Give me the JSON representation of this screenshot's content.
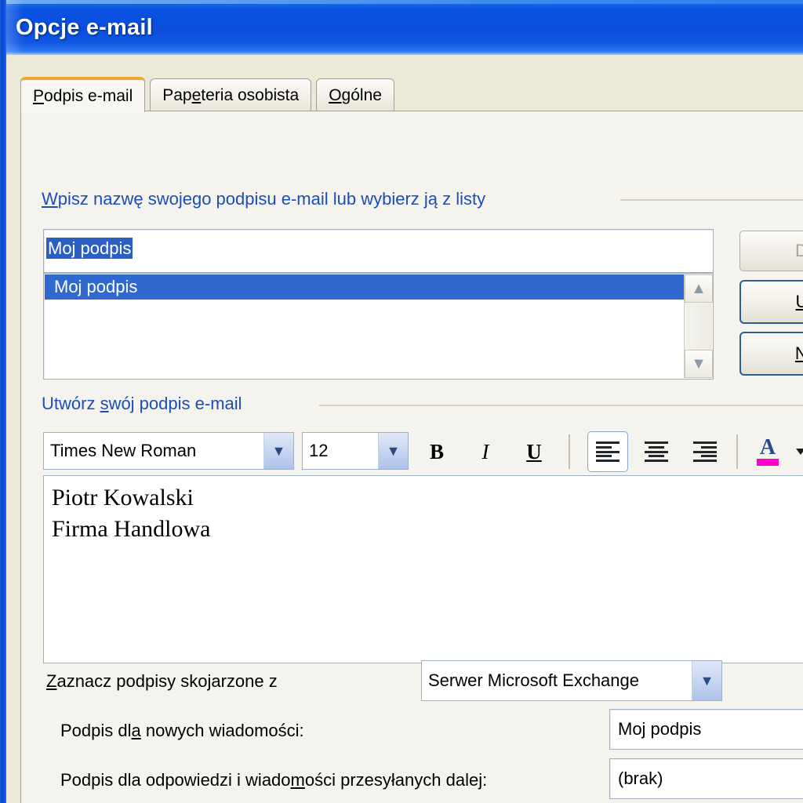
{
  "window": {
    "title": "Opcje e-mail",
    "accent_titlebar": "#0a4ddc",
    "accent_tab": "#f0a830"
  },
  "tabs": [
    {
      "label": "Podpis e-mail",
      "accesskey": "P",
      "active": true
    },
    {
      "label": "Papeteria osobista",
      "accesskey": "e",
      "active": false
    },
    {
      "label": "Ogólne",
      "accesskey": "O",
      "active": false
    }
  ],
  "signature_name_group": {
    "label": "Wpisz nazwę swojego podpisu e-mail lub wybierz ją z listy",
    "label_accesskey": "W",
    "name_input": {
      "value": "Moj podpis",
      "selected": true
    },
    "list": {
      "items": [
        "Moj podpis"
      ],
      "selected_index": 0,
      "scroll_up_icon": "chevron-up-icon",
      "scroll_down_icon": "chevron-down-icon"
    },
    "buttons": [
      {
        "label": "Dodaj",
        "accesskey": "D",
        "visible_text": "Do",
        "disabled": true,
        "default": false
      },
      {
        "label": "Usuń",
        "accesskey": "U",
        "visible_text": "Us",
        "disabled": false,
        "default": true
      },
      {
        "label": "Nowy",
        "accesskey": "N",
        "visible_text": "No",
        "disabled": false,
        "default": true
      }
    ]
  },
  "create_signature_group": {
    "label": "Utwórz swój podpis e-mail",
    "label_accesskey": "s",
    "toolbar": {
      "font_family": {
        "value": "Times New Roman"
      },
      "font_size": {
        "value": "12"
      },
      "bold": {
        "label": "B",
        "name": "bold-button"
      },
      "italic": {
        "label": "I",
        "name": "italic-button"
      },
      "underline": {
        "label": "U",
        "name": "underline-button"
      },
      "align_left": {
        "name": "align-left-button",
        "active": true
      },
      "align_center": {
        "name": "align-center-button",
        "active": false
      },
      "align_right": {
        "name": "align-right-button",
        "active": false
      },
      "font_color": {
        "glyph": "A",
        "swatch_color": "#ff00d0",
        "name": "font-color-button"
      }
    },
    "editor": {
      "lines": [
        "Piotr Kowalski",
        "Firma Handlowa"
      ]
    }
  },
  "associate_group": {
    "label": "Zaznacz podpisy skojarzone z",
    "label_accesskey": "Z",
    "account_combo": {
      "value": "Serwer Microsoft Exchange"
    },
    "rows": [
      {
        "label": "Podpis dla nowych wiadomości:",
        "label_accesskey": "a",
        "value": "Moj podpis"
      },
      {
        "label": "Podpis dla odpowiedzi i wiadomości przesyłanych dalej:",
        "label_accesskey": "m",
        "value": "(brak)"
      }
    ]
  }
}
